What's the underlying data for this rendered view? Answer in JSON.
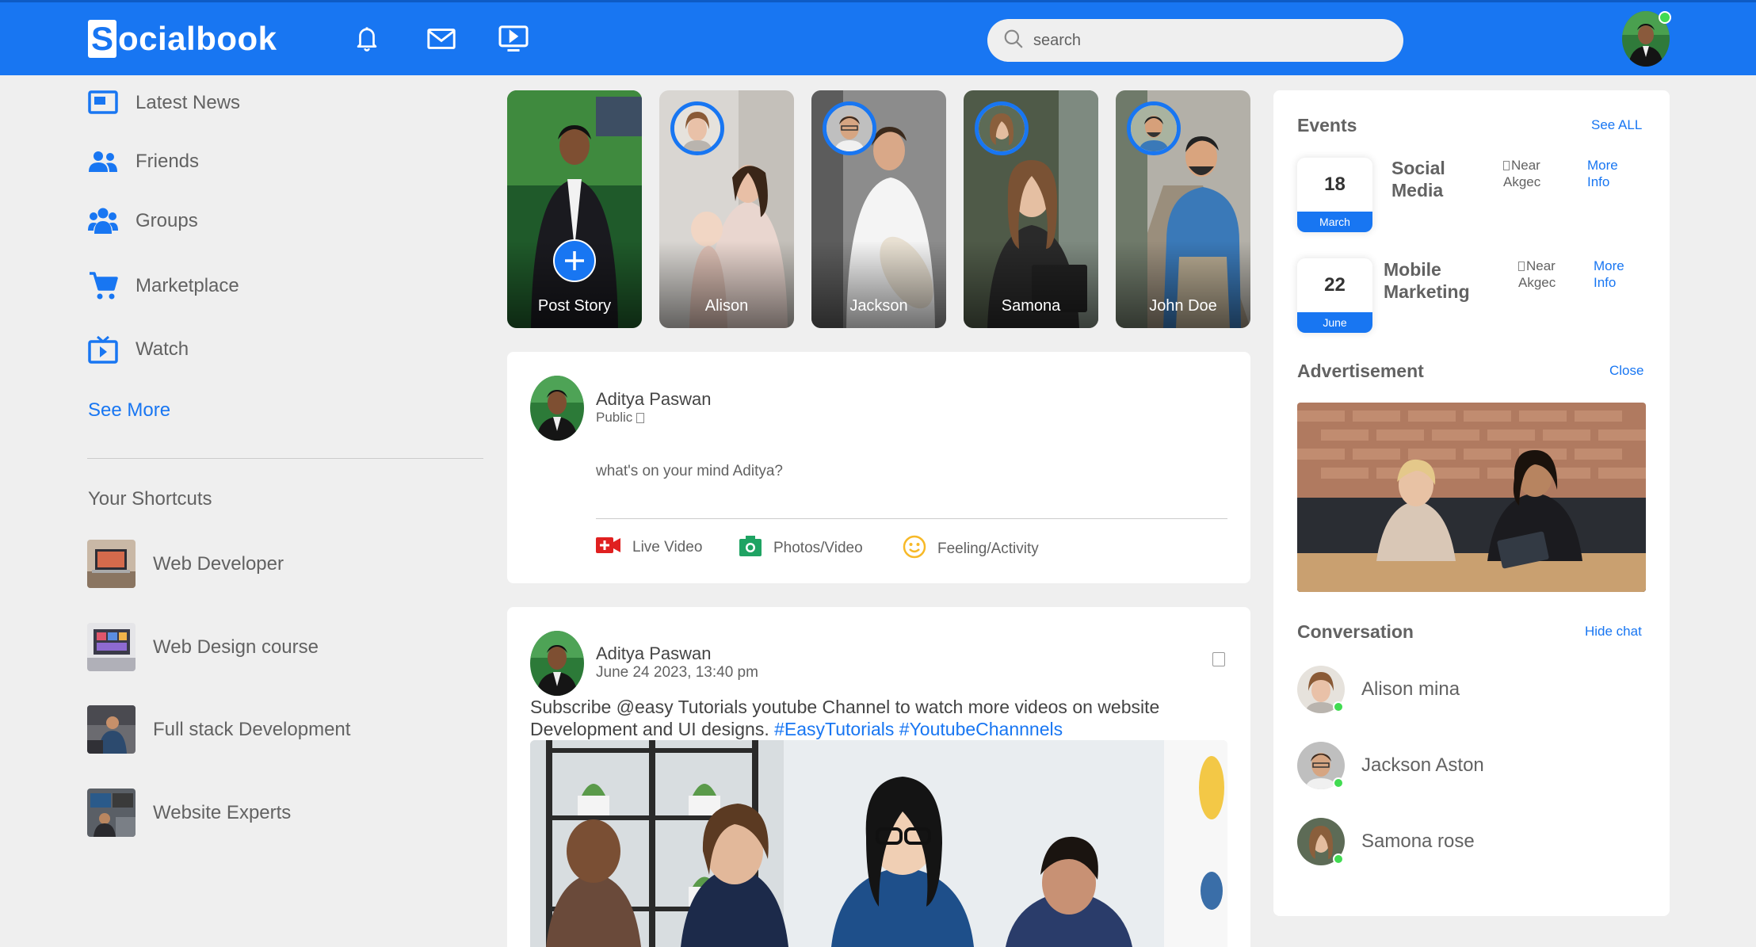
{
  "brand": {
    "logo_letter": "S",
    "logo_rest": "ocialbook"
  },
  "navbar": {
    "icons": [
      "bell-icon",
      "mail-icon",
      "video-icon"
    ],
    "search_placeholder": "search"
  },
  "sidebar": {
    "items": [
      {
        "label": "Latest News",
        "icon": "news-icon"
      },
      {
        "label": "Friends",
        "icon": "friends-icon"
      },
      {
        "label": "Groups",
        "icon": "groups-icon"
      },
      {
        "label": "Marketplace",
        "icon": "cart-icon"
      },
      {
        "label": "Watch",
        "icon": "watch-icon"
      }
    ],
    "see_more": "See More",
    "shortcuts_title": "Your Shortcuts",
    "shortcuts": [
      {
        "label": "Web Developer"
      },
      {
        "label": "Web Design course"
      },
      {
        "label": "Full stack Development"
      },
      {
        "label": "Website Experts"
      }
    ]
  },
  "stories": [
    {
      "name": "Post Story"
    },
    {
      "name": "Alison"
    },
    {
      "name": "Jackson"
    },
    {
      "name": "Samona"
    },
    {
      "name": "John Doe"
    }
  ],
  "composer": {
    "user_name": "Aditya Paswan",
    "privacy": "Public",
    "placeholder": "what's on your mind Aditya?",
    "actions": [
      {
        "label": "Live Video",
        "icon": "live-video-icon",
        "color": "#e02020"
      },
      {
        "label": "Photos/Video",
        "icon": "camera-icon",
        "color": "#1fa363"
      },
      {
        "label": "Feeling/Activity",
        "icon": "smiley-icon",
        "color": "#f7b928"
      }
    ]
  },
  "post": {
    "user_name": "Aditya Paswan",
    "timestamp": "June 24 2023, 13:40 pm",
    "text": "Subscribe @easy Tutorials youtube Channel to watch more videos on website Development and UI designs.",
    "hashtags": "#EasyTutorials #YoutubeChannnels"
  },
  "events": {
    "title": "Events",
    "see_all": "See ALL",
    "items": [
      {
        "day": "18",
        "month": "March",
        "title": "Social Media",
        "location": "Near Akgec",
        "more": "More Info"
      },
      {
        "day": "22",
        "month": "June",
        "title": "Mobile Marketing",
        "location": "Near Akgec",
        "more": "More Info"
      }
    ]
  },
  "advertisement": {
    "title": "Advertisement",
    "close": "Close"
  },
  "conversation": {
    "title": "Conversation",
    "hide": "Hide chat",
    "contacts": [
      {
        "name": "Alison mina",
        "online": true
      },
      {
        "name": "Jackson Aston",
        "online": true
      },
      {
        "name": "Samona rose",
        "online": true
      }
    ]
  },
  "colors": {
    "brand_blue": "#1876f2",
    "online_green": "#41db51",
    "page_bg": "#efefef"
  }
}
